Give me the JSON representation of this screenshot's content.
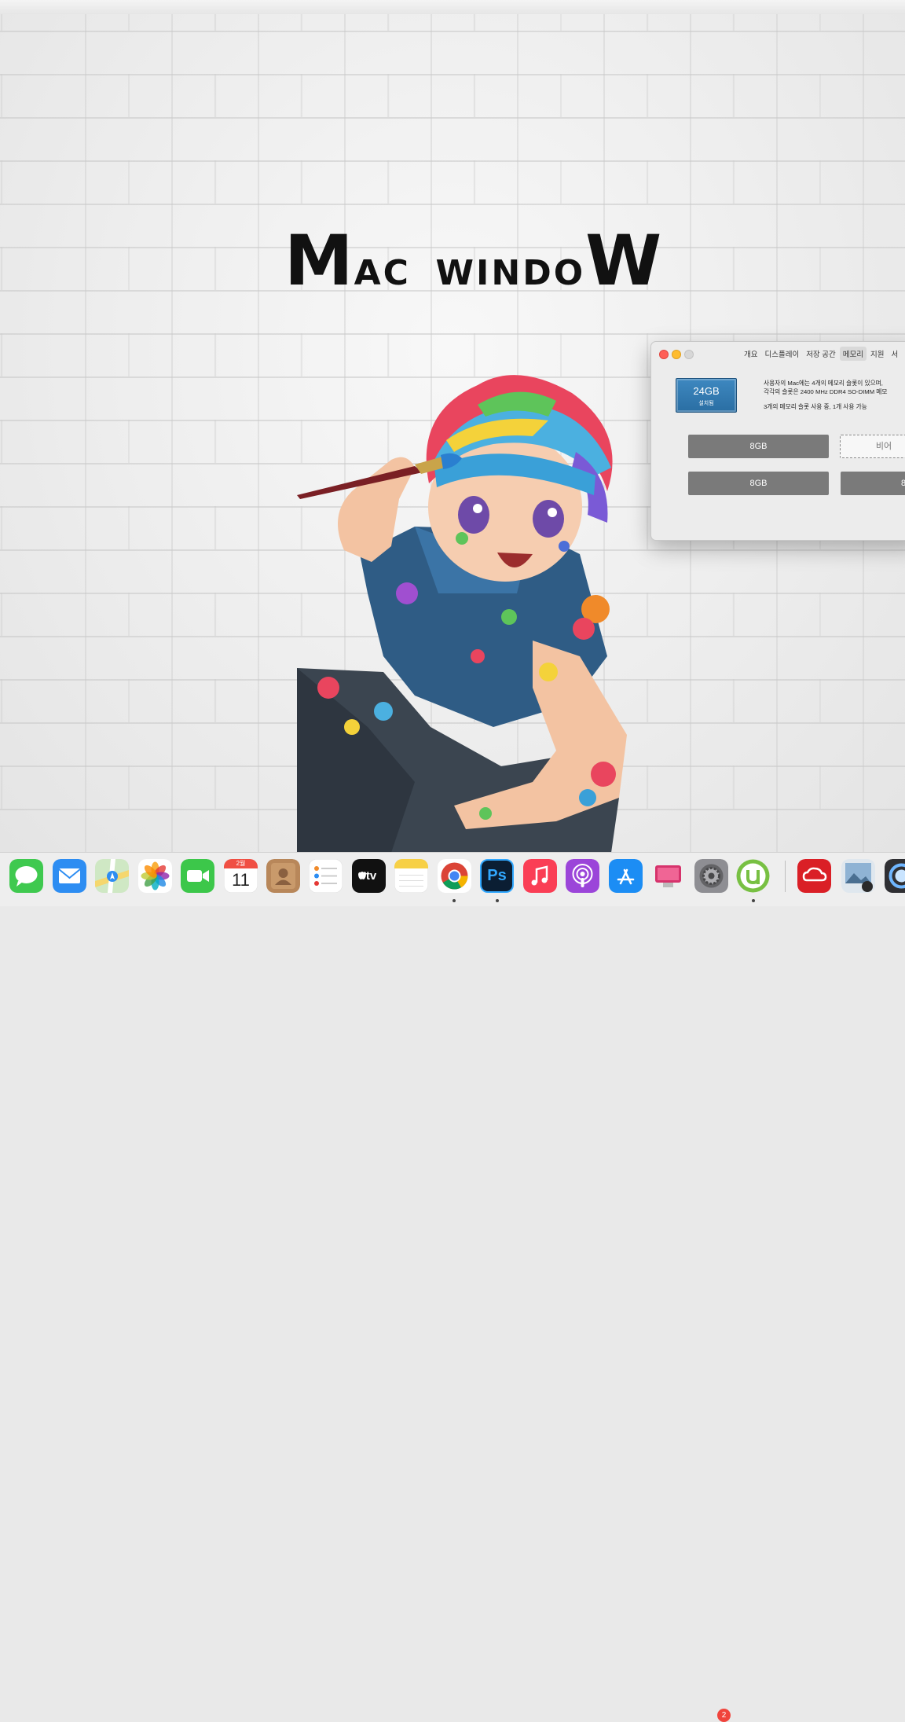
{
  "wallpaper": {
    "title_parts": [
      "M",
      "AC",
      "WINDO",
      "W"
    ]
  },
  "about_window": {
    "tabs": [
      "개요",
      "디스플레이",
      "저장 공간",
      "메모리",
      "지원",
      "서"
    ],
    "active_tab": "메모리",
    "memory_total": "24GB",
    "memory_status": "설치됨",
    "info_line1": "사용자의 Mac에는 4개의 메모리 슬롯이 있으며,",
    "info_line2": "각각의 슬롯은 2400 MHz DDR4 SO-DIMM 메모",
    "info_line3": "3개의 메모리 슬롯 사용 중, 1개 사용 가능",
    "slots": [
      "8GB",
      "비어",
      "8GB",
      "8"
    ]
  },
  "dock": {
    "apps": [
      "messages-icon",
      "mail-icon",
      "maps-icon",
      "photos-icon",
      "facetime-icon",
      "calendar-icon",
      "contacts-icon",
      "reminders-icon",
      "apple-tv-icon",
      "notes-icon",
      "chrome-icon",
      "photoshop-icon",
      "music-icon",
      "podcasts-icon",
      "app-store-icon",
      "cleanmymac-icon",
      "system-preferences-icon",
      "utorrent-icon",
      "creative-cloud-icon",
      "preview-icon",
      "quicktime-icon"
    ],
    "calendar_month": "2월",
    "calendar_day": "11",
    "photoshop_label": "Ps",
    "tv_label": "tv",
    "settings_badge": "2"
  }
}
